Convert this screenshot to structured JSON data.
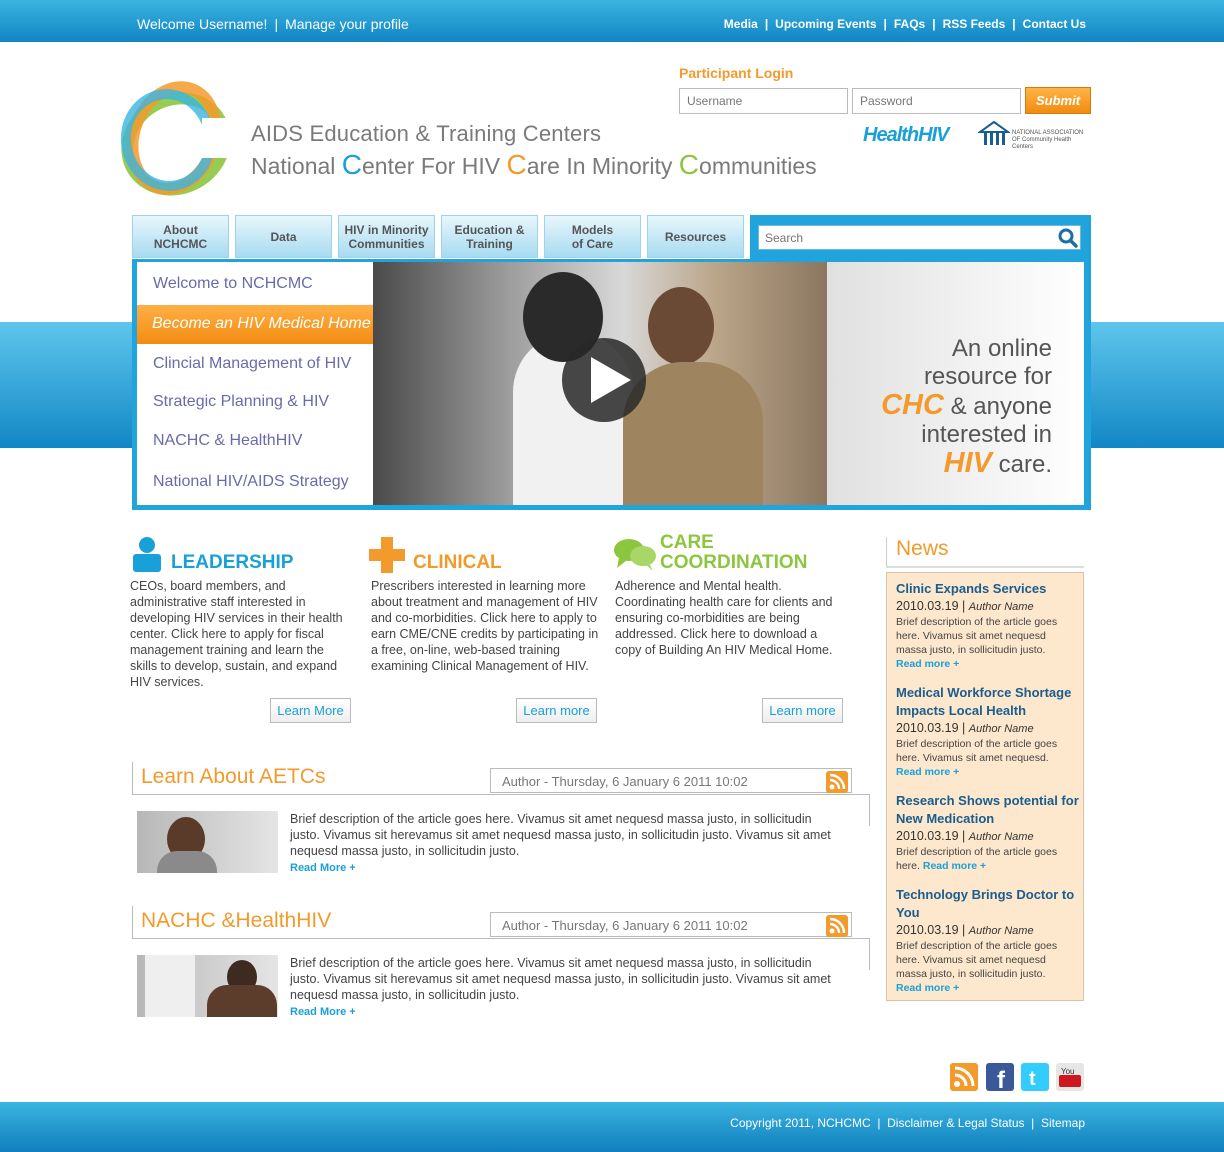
{
  "topbar": {
    "welcome": "Welcome Username!",
    "manage": "Manage your profile",
    "links": [
      "Media",
      "Upcoming Events",
      "FAQs",
      "RSS Feeds",
      "Contact Us"
    ]
  },
  "header": {
    "title_line1": "AIDS Education & Training Centers",
    "title_line2": {
      "p1": "National ",
      "c1": "C",
      "p2": "enter For HIV ",
      "c2": "C",
      "p3": "are In Minority ",
      "c3": "C",
      "p4": "ommunities"
    },
    "partner1": "HealthHIV",
    "partner2": "NATIONAL ASSOCIATION OF Community Health Centers"
  },
  "login": {
    "label": "Participant Login",
    "username_placeholder": "Username",
    "password_placeholder": "Password",
    "submit": "Submit"
  },
  "nav": {
    "tabs": [
      {
        "line1": "About",
        "line2": "NCHCMC"
      },
      {
        "line1": "Data",
        "line2": ""
      },
      {
        "line1": "HIV in Minority",
        "line2": "Communities"
      },
      {
        "line1": "Education &",
        "line2": "Training"
      },
      {
        "line1": "Models",
        "line2": "of Care"
      },
      {
        "line1": "Resources",
        "line2": ""
      }
    ],
    "search_placeholder": "Search"
  },
  "feature": {
    "menu": [
      "Welcome to NCHCMC",
      "Become an HIV Medical Home",
      "Clincial Management of HIV",
      "Strategic Planning & HIV",
      "NACHC & HealthHIV",
      "National HIV/AIDS Strategy"
    ],
    "tagline": {
      "l1": "An online",
      "l2": "resource for",
      "hl1": "CHC",
      "l3": " & anyone",
      "l4": "interested in",
      "hl2": "HIV",
      "l5": " care."
    }
  },
  "columns": [
    {
      "title": "LEADERSHIP",
      "text": "CEOs, board members, and administrative staff interested in developing HIV services in their health center.  Click here to apply for fiscal management training and learn the skills to develop, sustain, and expand HIV services.",
      "button": "Learn More",
      "color": "#1aa0d8"
    },
    {
      "title": "CLINICAL",
      "text": "Prescribers interested in learning more about treatment and management of HIV and co-morbidities. Click here to apply to earn CME/CNE credits by participating in a free, on-line, web-based training examining Clinical Management of HIV.",
      "button": "Learn more",
      "color": "#f39a2c"
    },
    {
      "title_l1": "CARE",
      "title_l2": "COORDINATION",
      "text": "Adherence and Mental health. Coordinating health care for clients and ensuring co-morbidities are being addressed.  Click here to download a copy of Building An HIV Medical Home.",
      "button": "Learn more",
      "color": "#8cc63f"
    }
  ],
  "sections": [
    {
      "heading": "Learn About AETCs",
      "byline": "Author - Thursday, 6 January 6 2011  10:02",
      "text": "Brief description of the article goes here. Vivamus sit amet nequesd massa justo, in sollicitudin justo. Vivamus sit herevamus sit amet nequesd massa justo, in sollicitudin justo. Vivamus sit amet nequesd massa justo, in sollicitudin justo.",
      "read_more": "Read More +"
    },
    {
      "heading": "NACHC &HealthHIV",
      "byline": "Author - Thursday, 6 January 6 2011  10:02",
      "text": "Brief description of the article goes here. Vivamus sit amet nequesd massa justo, in sollicitudin justo. Vivamus sit herevamus sit amet nequesd massa justo, in sollicitudin justo. Vivamus sit amet nequesd massa justo, in sollicitudin justo.",
      "read_more": "Read More +"
    }
  ],
  "news": {
    "heading": "News",
    "items": [
      {
        "title": "Clinic Expands Services",
        "date": "2010.03.19",
        "author": "Author Name",
        "desc": "Brief description of the article goes here. Vivamus sit amet nequesd massa justo, in sollicitudin justo.",
        "read_more": "Read more +"
      },
      {
        "title": "Medical Workforce Shortage Impacts Local Health",
        "date": "2010.03.19",
        "author": "Author Name",
        "desc": "Brief description of the article goes here. Vivamus sit amet nequesd.",
        "read_more": "Read more +"
      },
      {
        "title": "Research Shows potential for New Medication",
        "date": "2010.03.19",
        "author": "Author Name",
        "desc": "Brief description of the article goes here.",
        "read_more": "Read more +"
      },
      {
        "title": "Technology Brings Doctor to You",
        "date": "2010.03.19",
        "author": "Author Name",
        "desc": "Brief description of the article goes here. Vivamus sit amet nequesd massa justo, in sollicitudin justo.",
        "read_more": "Read more +"
      }
    ]
  },
  "social": [
    "rss-icon",
    "facebook-icon",
    "twitter-icon",
    "youtube-icon"
  ],
  "footer": {
    "copyright": "Copyright 2011, NCHCMC",
    "disclaimer": "Disclaimer & Legal Status",
    "sitemap": "Sitemap"
  }
}
